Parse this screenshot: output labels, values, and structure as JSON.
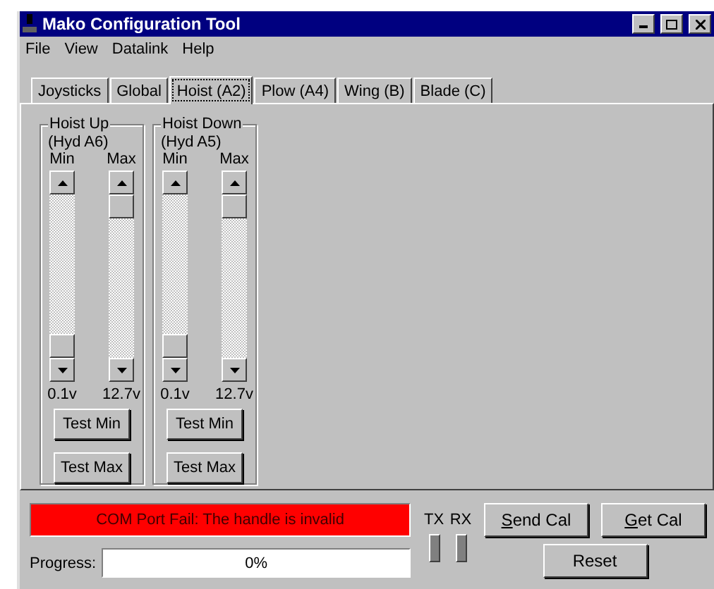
{
  "window": {
    "title": "Mako Configuration Tool"
  },
  "menu": [
    "File",
    "View",
    "Datalink",
    "Help"
  ],
  "tabs": [
    {
      "label": "Joysticks",
      "selected": false
    },
    {
      "label": "Global",
      "selected": false
    },
    {
      "label": "Hoist (A2)",
      "selected": true
    },
    {
      "label": "Plow (A4)",
      "selected": false
    },
    {
      "label": "Wing (B)",
      "selected": false
    },
    {
      "label": "Blade (C)",
      "selected": false
    }
  ],
  "groups": [
    {
      "title": "Hoist Up",
      "subtitle": "(Hyd A6)",
      "sliders": [
        {
          "label": "Min",
          "level": 0.0,
          "reading": "0.1v"
        },
        {
          "label": "Max",
          "level": 1.0,
          "reading": "12.7v"
        }
      ],
      "buttons": [
        "Test Min",
        "Test Max"
      ]
    },
    {
      "title": "Hoist Down",
      "subtitle": "(Hyd A5)",
      "sliders": [
        {
          "label": "Min",
          "level": 0.0,
          "reading": "0.1v"
        },
        {
          "label": "Max",
          "level": 1.0,
          "reading": "12.7v"
        }
      ],
      "buttons": [
        "Test Min",
        "Test Max"
      ]
    }
  ],
  "status": {
    "text": "COM Port Fail: The handle is invalid",
    "color": "#ff0000"
  },
  "progress": {
    "label": "Progress:",
    "reading": "0%"
  },
  "indicators": [
    {
      "label": "TX",
      "on": false
    },
    {
      "label": "RX",
      "on": false
    }
  ],
  "buttons": [
    {
      "label": "Send Cal",
      "mnemonic": true
    },
    {
      "label": "Get Cal",
      "mnemonic": true
    },
    {
      "label": "Reset",
      "mnemonic": false
    }
  ]
}
